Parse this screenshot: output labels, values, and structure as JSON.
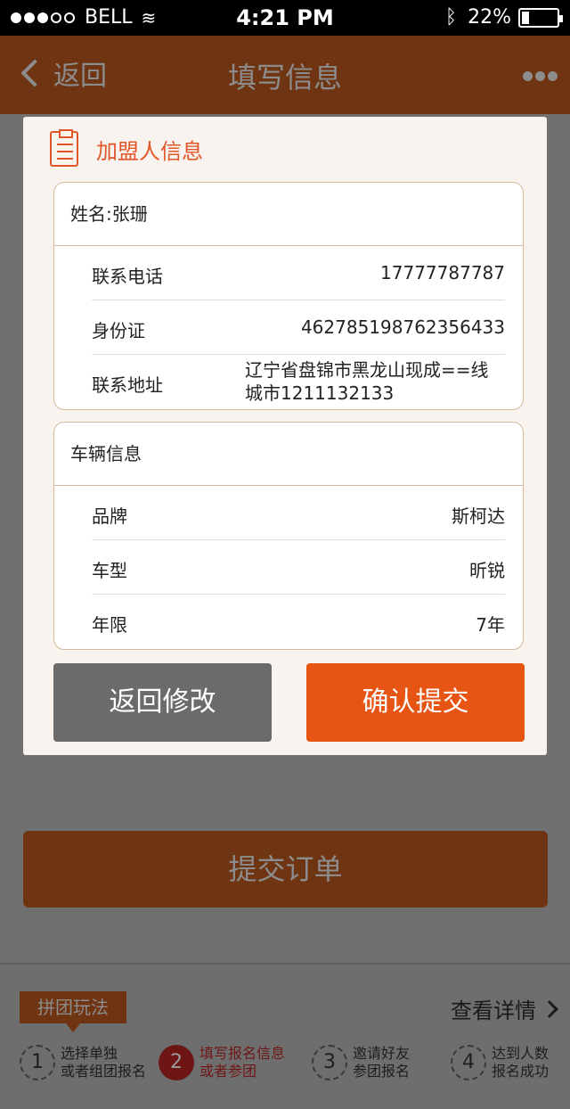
{
  "status_bar": {
    "carrier": "BELL",
    "time": "4:21 PM",
    "battery_text": "22%",
    "battery_level": 0.22,
    "signal_dots_on": 3,
    "signal_dots_total": 5
  },
  "navbar": {
    "back_label": "返回",
    "title": "填写信息"
  },
  "modal": {
    "title": "加盟人信息",
    "person_card": {
      "header": "姓名:张珊",
      "rows": [
        {
          "label": "联系电话",
          "value": "17777787787"
        },
        {
          "label": "身份证",
          "value": "462785198762356433"
        },
        {
          "label": "联系地址",
          "value": "辽宁省盘锦市黑龙山现成==线城市1211132133"
        }
      ]
    },
    "vehicle_card": {
      "header": "车辆信息",
      "rows": [
        {
          "label": "品牌",
          "value": "斯柯达"
        },
        {
          "label": "车型",
          "value": "昕锐"
        },
        {
          "label": "年限",
          "value": "7年"
        }
      ]
    },
    "back_button": "返回修改",
    "confirm_button": "确认提交"
  },
  "submit_order_label": "提交订单",
  "bottom": {
    "tag": "拼团玩法",
    "details_link": "查看详情",
    "steps": [
      {
        "num": "1",
        "line1": "选择单独",
        "line2": "或者组团报名"
      },
      {
        "num": "2",
        "line1": "填写报名信息",
        "line2": "或者参团"
      },
      {
        "num": "3",
        "line1": "邀请好友",
        "line2": "参团报名"
      },
      {
        "num": "4",
        "line1": "达到人数",
        "line2": "报名成功"
      }
    ]
  },
  "colors": {
    "accent": "#e65514",
    "navbar_dim": "#6f3412",
    "overlay": "#707070"
  }
}
